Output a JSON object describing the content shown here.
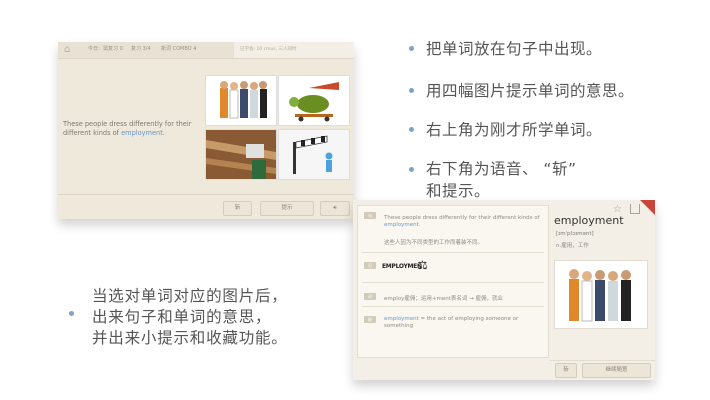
{
  "screen1": {
    "stats": [
      "今日：需复习 0",
      "复习 3/4",
      "新词 COMBO 4"
    ],
    "learned_words": "已学会: 10 cmus, 三人同时",
    "sentence_before": "These people dress differently for their different kinds of ",
    "keyword": "employment",
    "sentence_after": ".",
    "buttons": {
      "chop": "斩",
      "hint": "提示"
    }
  },
  "bullets": [
    "把单词放在句子中出现。",
    "用四幅图片提示单词的意思。",
    "右上角为刚才所学单词。",
    "右下角为语音、 “斩”",
    "和提示。"
  ],
  "screen2": {
    "sentence_before": "These people dress differently for their different kinds of ",
    "keyword": "employment",
    "sentence_after": ".",
    "translation": "这些人因为不同类型的工作而着装不同。",
    "wordart": "EMPLOYMEN",
    "etymology": "employ雇佣；运用+ment表名词 → 雇佣，就业",
    "definition_word": "employment",
    "definition_rest": " = the act of employing someone or something",
    "word": "employment",
    "phonetic": "[ɪmˈplɔɪmənt]",
    "pos": "n.雇用，工作",
    "buttons": {
      "chop": "斩",
      "next": "继续随意"
    }
  },
  "bottom_left": [
    "当选对单词对应的图片后，",
    "出来句子和单词的意思，",
    "并出来小提示和收藏功能。"
  ],
  "colors": {
    "accent": "#6a96c8",
    "bullet": "#7da3c9",
    "ribbon": "#c9453a"
  }
}
